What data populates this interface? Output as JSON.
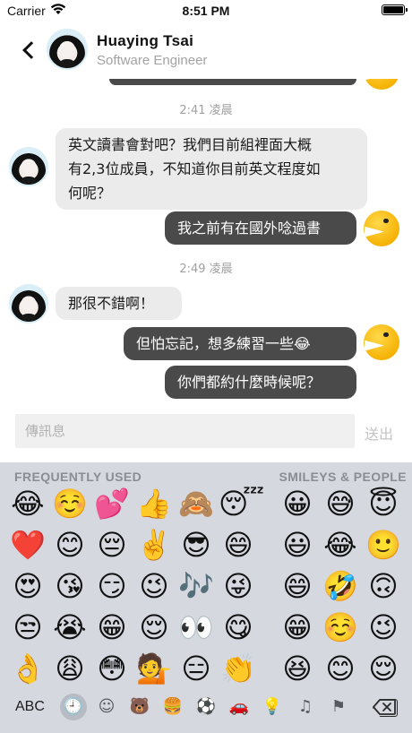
{
  "status_bar": {
    "carrier": "Carrier",
    "time": "8:51 PM"
  },
  "header": {
    "name": "Huaying Tsai",
    "title": "Software Engineer"
  },
  "messages": [
    {
      "type": "timestamp",
      "text": "2:41 凌晨"
    },
    {
      "type": "in",
      "lines": [
        "英文讀書會對吧？我們目前組裡面大概",
        "有2,3位成員，不知道你目前英文程度如",
        "何呢？"
      ]
    },
    {
      "type": "out",
      "lines": [
        "我之前有在國外唸過書"
      ]
    },
    {
      "type": "timestamp",
      "text": "2:49 凌晨"
    },
    {
      "type": "in",
      "lines": [
        "那很不錯啊！"
      ]
    },
    {
      "type": "out",
      "lines": [
        "但怕忘記，想多練習一些😂"
      ]
    },
    {
      "type": "out",
      "lines": [
        "你們都約什麼時候呢？"
      ]
    }
  ],
  "input": {
    "placeholder": "傳訊息",
    "send_label": "送出"
  },
  "keyboard": {
    "label_left": "FREQUENTLY USED",
    "label_right": "SMILEYS & PEOPLE",
    "frequent": [
      [
        "😂",
        "☺️",
        "💕",
        "👍",
        "🙈",
        "😴"
      ],
      [
        "❤️",
        "😊",
        "😔",
        "✌️",
        "😎",
        "😄"
      ],
      [
        "😍",
        "😘",
        "😏",
        "😉",
        "🎶",
        "😜"
      ],
      [
        "😒",
        "😭",
        "😁",
        "😌",
        "👀",
        "😋"
      ],
      [
        "👌",
        "😩",
        "😳",
        "💁",
        "😑",
        "👏"
      ]
    ],
    "smileys": [
      [
        "😀",
        "😅",
        "😇"
      ],
      [
        "😃",
        "😂",
        "🙂"
      ],
      [
        "😄",
        "🤣",
        "🙃"
      ],
      [
        "😁",
        "☺️",
        "😉"
      ],
      [
        "😆",
        "😊",
        "😌"
      ]
    ],
    "abc_label": "ABC",
    "categories": [
      "🕘",
      "☺",
      "🐻",
      "🍔",
      "⚽",
      "🚗",
      "💡",
      "♫",
      "⚑"
    ]
  }
}
